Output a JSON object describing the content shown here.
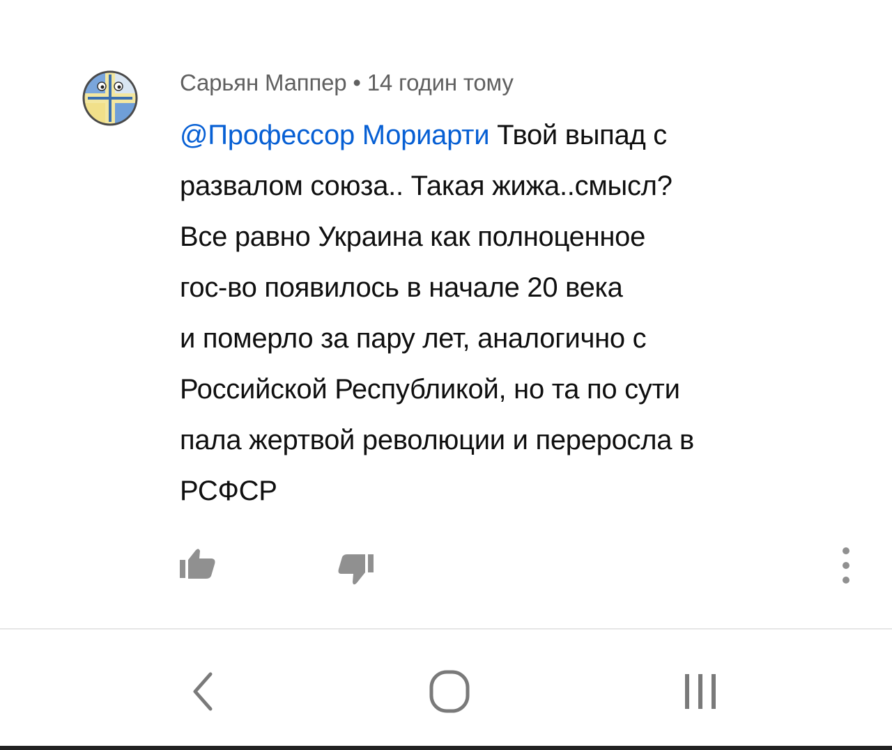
{
  "comment": {
    "author": "Сарьян Маппер",
    "separator": "•",
    "time": "14 годин тому",
    "mention": "@Профессор Мориарти",
    "body_lines": [
      " Твой выпад с",
      "развалом союза.. Такая жижа..смысл?",
      "Все равно Украина как полноценное",
      "гос-во появилось в начале 20 века",
      "и померло за пару лет, аналогично с",
      "Российской Республикой, но та по сути",
      "пала жертвой революции и переросла в",
      "РСФСР"
    ],
    "actions": {
      "like_icon": "thumb-up-icon",
      "dislike_icon": "thumb-down-icon",
      "more_icon": "more-vertical-icon"
    }
  },
  "navigation": {
    "back_icon": "chevron-left-icon",
    "home_icon": "home-rounded-square-icon",
    "recent_icon": "recent-apps-icon"
  },
  "colors": {
    "mention": "#065fd4",
    "meta_text": "#606060",
    "body_text": "#0f0f0f",
    "icon": "#909090",
    "avatar_blue": "#6f9fd8",
    "avatar_yellow": "#f1e08a"
  }
}
